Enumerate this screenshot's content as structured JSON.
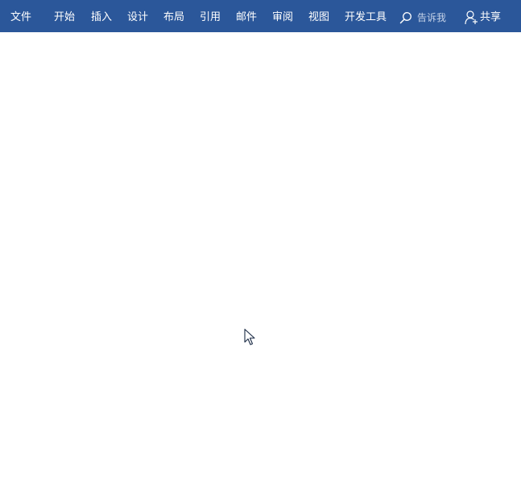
{
  "ribbon": {
    "background_color": "#2b579a",
    "tabs": [
      {
        "id": "file",
        "label": "文件"
      },
      {
        "id": "home",
        "label": "开始"
      },
      {
        "id": "insert",
        "label": "插入"
      },
      {
        "id": "design",
        "label": "设计"
      },
      {
        "id": "layout",
        "label": "布局"
      },
      {
        "id": "references",
        "label": "引用"
      },
      {
        "id": "mailings",
        "label": "邮件"
      },
      {
        "id": "review",
        "label": "审阅"
      },
      {
        "id": "view",
        "label": "视图"
      },
      {
        "id": "developer",
        "label": "开发工具"
      }
    ],
    "tell_me": {
      "icon": "search-icon",
      "label": "告诉我"
    },
    "share": {
      "icon": "person-add-icon",
      "label": "共享"
    }
  },
  "document": {
    "background_color": "#ffffff"
  },
  "mouse_cursor": {
    "icon": "arrow-pointer-icon"
  }
}
